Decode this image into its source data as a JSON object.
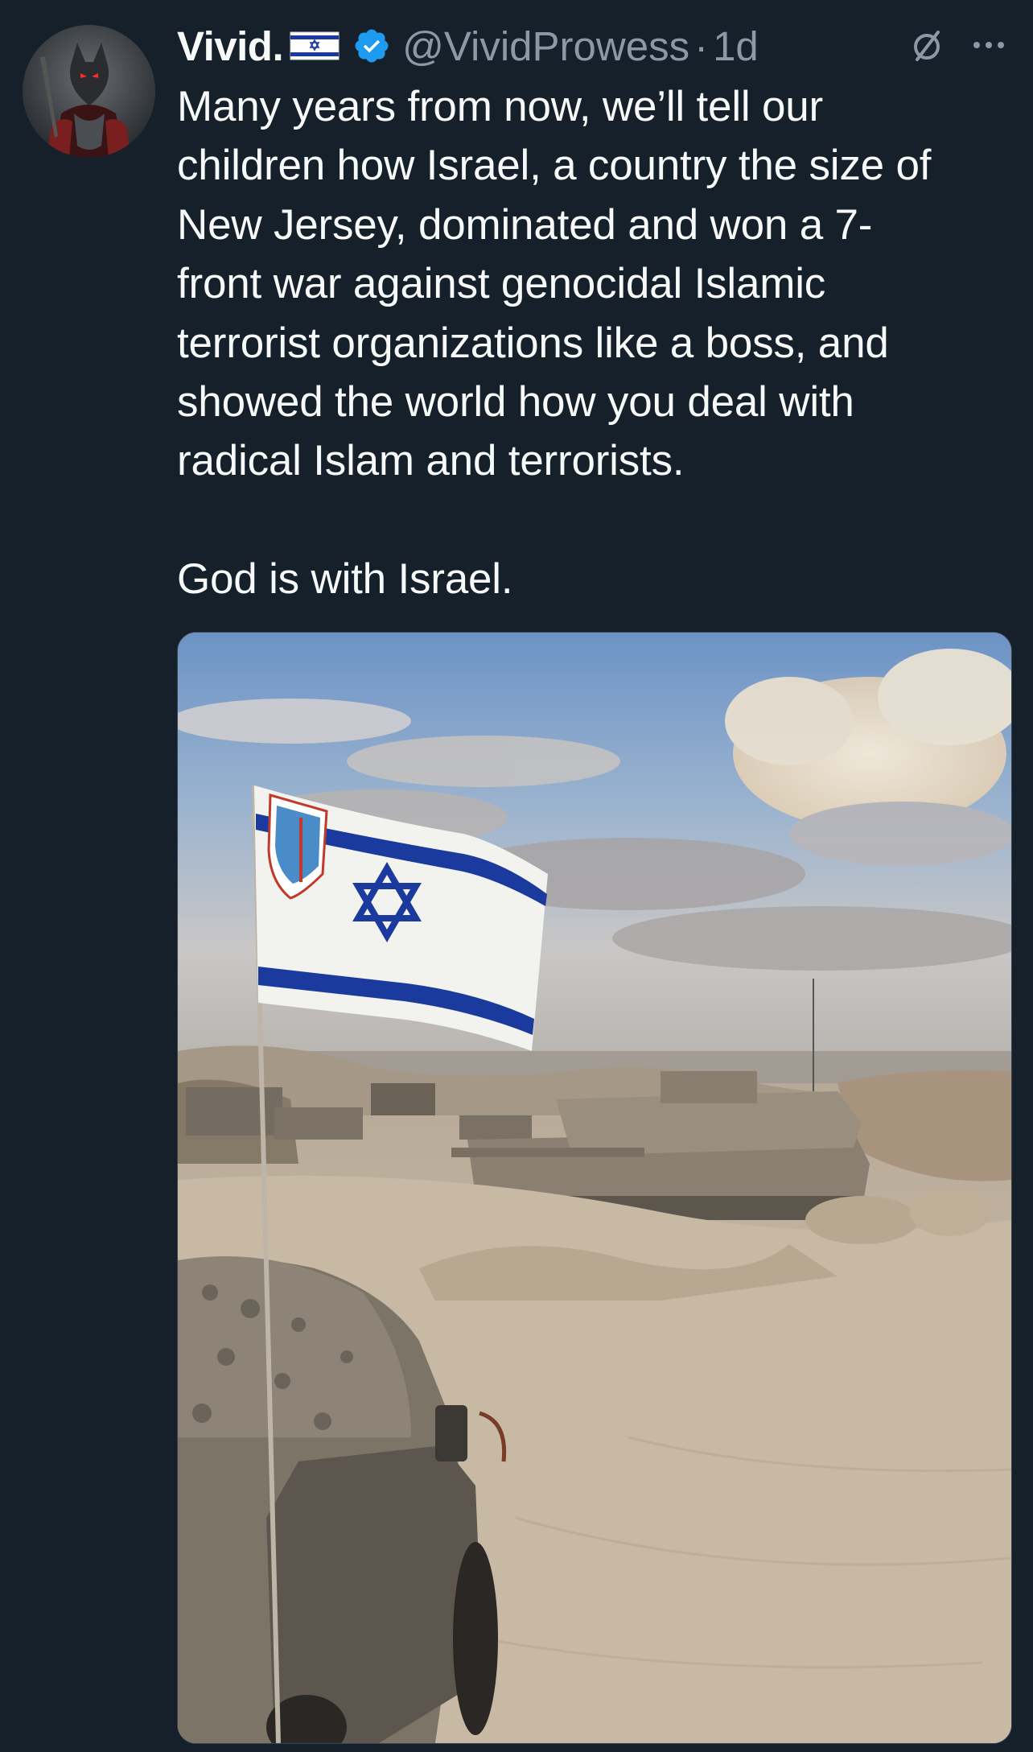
{
  "tweet": {
    "display_name": "Vivid.",
    "handle": "@VividProwess",
    "separator": "·",
    "time": "1d",
    "text": "Many years from now, we’ll tell our\nchildren how Israel, a country the size of\nNew Jersey, dominated and won a 7-\nfront war against genocidal Islamic\nterrorist organizations like a boss, and\nshowed the world how you deal with\nradical Islam and terrorists.\n\nGod is with Israel.",
    "icons": {
      "flag": "israel-flag-emoji",
      "verified": "verified-badge-icon",
      "mute": "muted-icon",
      "more": "more-options-icon"
    },
    "colors": {
      "background": "#15202b",
      "primary_text": "#f7f9f9",
      "secondary_text": "#8b98a5",
      "verified_blue": "#1d9bf0",
      "flag_blue": "#1b3a9e"
    }
  }
}
